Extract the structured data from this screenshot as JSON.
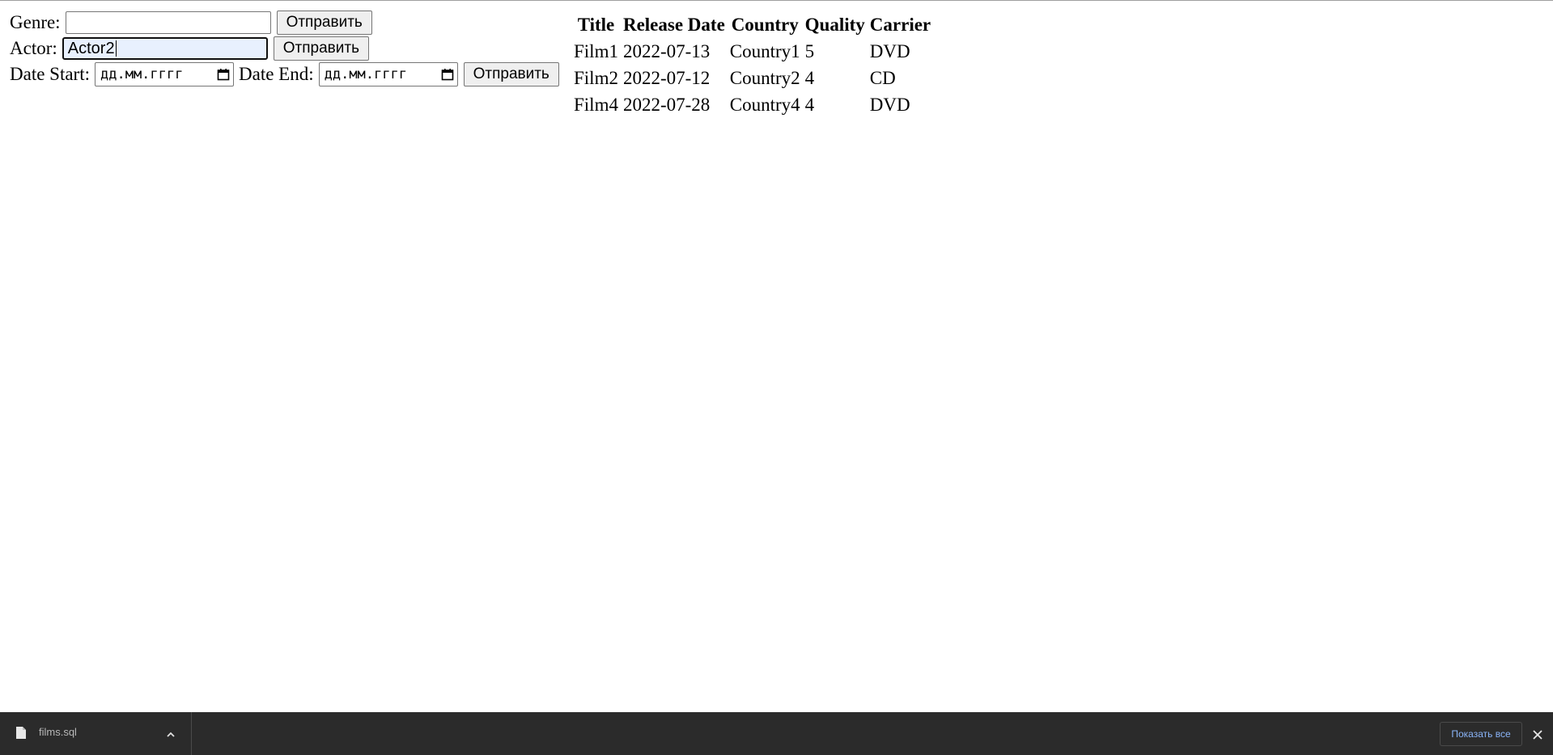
{
  "genre_form": {
    "label": "Genre:",
    "value": "",
    "submit_label": "Отправить"
  },
  "actor_form": {
    "label": "Actor:",
    "value": "Actor2",
    "submit_label": "Отправить"
  },
  "date_form": {
    "start_label": "Date Start:",
    "start_placeholder": "дд.мм.гггг",
    "end_label": "Date End:",
    "end_placeholder": "дд.мм.гггг",
    "submit_label": "Отправить"
  },
  "table": {
    "headers": [
      "Title",
      "Release Date",
      "Country",
      "Quality",
      "Carrier"
    ],
    "rows": [
      [
        "Film1",
        "2022-07-13",
        "Country1",
        "5",
        "DVD"
      ],
      [
        "Film2",
        "2022-07-12",
        "Country2",
        "4",
        "CD"
      ],
      [
        "Film4",
        "2022-07-28",
        "Country4",
        "4",
        "DVD"
      ]
    ]
  },
  "download_bar": {
    "file_name": "films.sql",
    "show_all_label": "Показать все"
  }
}
